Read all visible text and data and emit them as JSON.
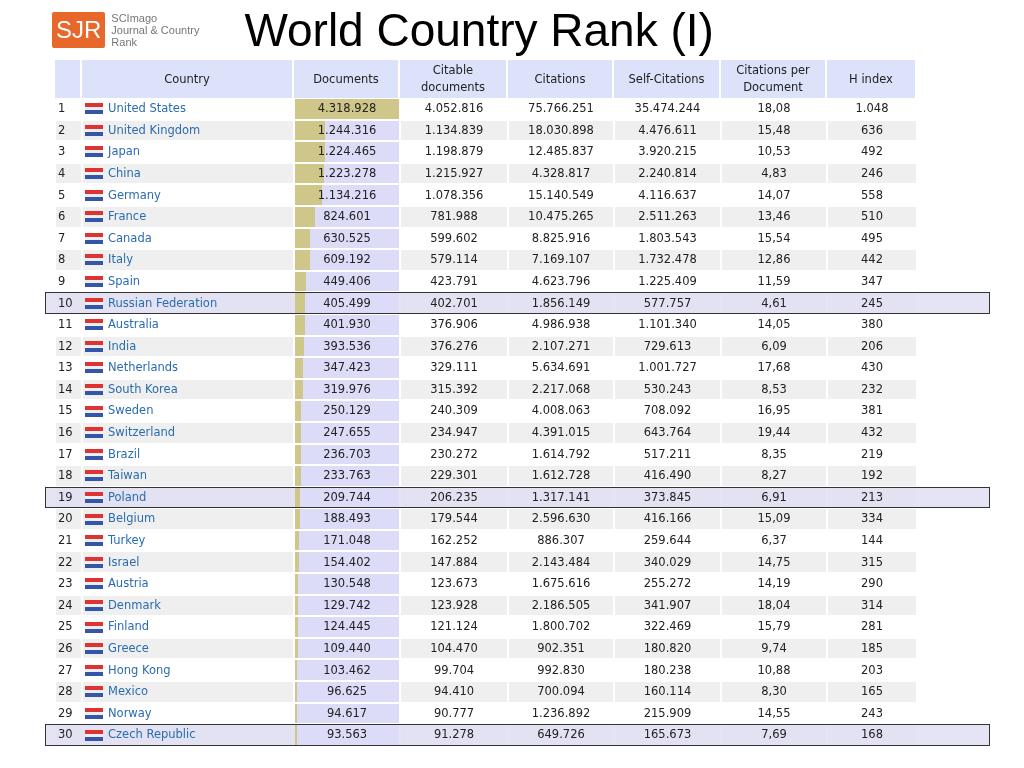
{
  "logo": {
    "mark": "SJR",
    "lines": [
      "SCImago",
      "Journal & Country",
      "Rank"
    ]
  },
  "title": "World Country Rank (I)",
  "table": {
    "columns": [
      "Country",
      "Documents",
      "Citable documents",
      "Citations",
      "Self-Citations",
      "Citations per Document",
      "H index"
    ],
    "rows": [
      {
        "rank": "1",
        "country": "United States",
        "documents": "4.318.928",
        "level": 1.0,
        "citable": "4.052.816",
        "citations": "75.766.251",
        "self_citations": "35.474.244",
        "per_document": "18,08",
        "h_index": "1.048",
        "selected": false
      },
      {
        "rank": "2",
        "country": "United Kingdom",
        "documents": "1.244.316",
        "level": 0.288,
        "citable": "1.134.839",
        "citations": "18.030.898",
        "self_citations": "4.476.611",
        "per_document": "15,48",
        "h_index": "636",
        "selected": false
      },
      {
        "rank": "3",
        "country": "Japan",
        "documents": "1.224.465",
        "level": 0.284,
        "citable": "1.198.879",
        "citations": "12.485.837",
        "self_citations": "3.920.215",
        "per_document": "10,53",
        "h_index": "492",
        "selected": false
      },
      {
        "rank": "4",
        "country": "China",
        "documents": "1.223.278",
        "level": 0.283,
        "citable": "1.215.927",
        "citations": "4.328.817",
        "self_citations": "2.240.814",
        "per_document": "4,83",
        "h_index": "246",
        "selected": false
      },
      {
        "rank": "5",
        "country": "Germany",
        "documents": "1.134.216",
        "level": 0.263,
        "citable": "1.078.356",
        "citations": "15.140.549",
        "self_citations": "4.116.637",
        "per_document": "14,07",
        "h_index": "558",
        "selected": false
      },
      {
        "rank": "6",
        "country": "France",
        "documents": "824.601",
        "level": 0.191,
        "citable": "781.988",
        "citations": "10.475.265",
        "self_citations": "2.511.263",
        "per_document": "13,46",
        "h_index": "510",
        "selected": false
      },
      {
        "rank": "7",
        "country": "Canada",
        "documents": "630.525",
        "level": 0.146,
        "citable": "599.602",
        "citations": "8.825.916",
        "self_citations": "1.803.543",
        "per_document": "15,54",
        "h_index": "495",
        "selected": false
      },
      {
        "rank": "8",
        "country": "Italy",
        "documents": "609.192",
        "level": 0.141,
        "citable": "579.114",
        "citations": "7.169.107",
        "self_citations": "1.732.478",
        "per_document": "12,86",
        "h_index": "442",
        "selected": false
      },
      {
        "rank": "9",
        "country": "Spain",
        "documents": "449.406",
        "level": 0.104,
        "citable": "423.791",
        "citations": "4.623.796",
        "self_citations": "1.225.409",
        "per_document": "11,59",
        "h_index": "347",
        "selected": false
      },
      {
        "rank": "10",
        "country": "Russian Federation",
        "documents": "405.499",
        "level": 0.094,
        "citable": "402.701",
        "citations": "1.856.149",
        "self_citations": "577.757",
        "per_document": "4,61",
        "h_index": "245",
        "selected": true
      },
      {
        "rank": "11",
        "country": "Australia",
        "documents": "401.930",
        "level": 0.093,
        "citable": "376.906",
        "citations": "4.986.938",
        "self_citations": "1.101.340",
        "per_document": "14,05",
        "h_index": "380",
        "selected": false
      },
      {
        "rank": "12",
        "country": "India",
        "documents": "393.536",
        "level": 0.091,
        "citable": "376.276",
        "citations": "2.107.271",
        "self_citations": "729.613",
        "per_document": "6,09",
        "h_index": "206",
        "selected": false
      },
      {
        "rank": "13",
        "country": "Netherlands",
        "documents": "347.423",
        "level": 0.08,
        "citable": "329.111",
        "citations": "5.634.691",
        "self_citations": "1.001.727",
        "per_document": "17,68",
        "h_index": "430",
        "selected": false
      },
      {
        "rank": "14",
        "country": "South Korea",
        "documents": "319.976",
        "level": 0.074,
        "citable": "315.392",
        "citations": "2.217.068",
        "self_citations": "530.243",
        "per_document": "8,53",
        "h_index": "232",
        "selected": false
      },
      {
        "rank": "15",
        "country": "Sweden",
        "documents": "250.129",
        "level": 0.058,
        "citable": "240.309",
        "citations": "4.008.063",
        "self_citations": "708.092",
        "per_document": "16,95",
        "h_index": "381",
        "selected": false
      },
      {
        "rank": "16",
        "country": "Switzerland",
        "documents": "247.655",
        "level": 0.057,
        "citable": "234.947",
        "citations": "4.391.015",
        "self_citations": "643.764",
        "per_document": "19,44",
        "h_index": "432",
        "selected": false
      },
      {
        "rank": "17",
        "country": "Brazil",
        "documents": "236.703",
        "level": 0.055,
        "citable": "230.272",
        "citations": "1.614.792",
        "self_citations": "517.211",
        "per_document": "8,35",
        "h_index": "219",
        "selected": false
      },
      {
        "rank": "18",
        "country": "Taiwan",
        "documents": "233.763",
        "level": 0.054,
        "citable": "229.301",
        "citations": "1.612.728",
        "self_citations": "416.490",
        "per_document": "8,27",
        "h_index": "192",
        "selected": false
      },
      {
        "rank": "19",
        "country": "Poland",
        "documents": "209.744",
        "level": 0.049,
        "citable": "206.235",
        "citations": "1.317.141",
        "self_citations": "373.845",
        "per_document": "6,91",
        "h_index": "213",
        "selected": true
      },
      {
        "rank": "20",
        "country": "Belgium",
        "documents": "188.493",
        "level": 0.044,
        "citable": "179.544",
        "citations": "2.596.630",
        "self_citations": "416.166",
        "per_document": "15,09",
        "h_index": "334",
        "selected": false
      },
      {
        "rank": "21",
        "country": "Turkey",
        "documents": "171.048",
        "level": 0.04,
        "citable": "162.252",
        "citations": "886.307",
        "self_citations": "259.644",
        "per_document": "6,37",
        "h_index": "144",
        "selected": false
      },
      {
        "rank": "22",
        "country": "Israel",
        "documents": "154.402",
        "level": 0.036,
        "citable": "147.884",
        "citations": "2.143.484",
        "self_citations": "340.029",
        "per_document": "14,75",
        "h_index": "315",
        "selected": false
      },
      {
        "rank": "23",
        "country": "Austria",
        "documents": "130.548",
        "level": 0.03,
        "citable": "123.673",
        "citations": "1.675.616",
        "self_citations": "255.272",
        "per_document": "14,19",
        "h_index": "290",
        "selected": false
      },
      {
        "rank": "24",
        "country": "Denmark",
        "documents": "129.742",
        "level": 0.03,
        "citable": "123.928",
        "citations": "2.186.505",
        "self_citations": "341.907",
        "per_document": "18,04",
        "h_index": "314",
        "selected": false
      },
      {
        "rank": "25",
        "country": "Finland",
        "documents": "124.445",
        "level": 0.029,
        "citable": "121.124",
        "citations": "1.800.702",
        "self_citations": "322.469",
        "per_document": "15,79",
        "h_index": "281",
        "selected": false
      },
      {
        "rank": "26",
        "country": "Greece",
        "documents": "109.440",
        "level": 0.025,
        "citable": "104.470",
        "citations": "902.351",
        "self_citations": "180.820",
        "per_document": "9,74",
        "h_index": "185",
        "selected": false
      },
      {
        "rank": "27",
        "country": "Hong Kong",
        "documents": "103.462",
        "level": 0.024,
        "citable": "99.704",
        "citations": "992.830",
        "self_citations": "180.238",
        "per_document": "10,88",
        "h_index": "203",
        "selected": false
      },
      {
        "rank": "28",
        "country": "Mexico",
        "documents": "96.625",
        "level": 0.022,
        "citable": "94.410",
        "citations": "700.094",
        "self_citations": "160.114",
        "per_document": "8,30",
        "h_index": "165",
        "selected": false
      },
      {
        "rank": "29",
        "country": "Norway",
        "documents": "94.617",
        "level": 0.022,
        "citable": "90.777",
        "citations": "1.236.892",
        "self_citations": "215.909",
        "per_document": "14,55",
        "h_index": "243",
        "selected": false
      },
      {
        "rank": "30",
        "country": "Czech Republic",
        "documents": "93.563",
        "level": 0.022,
        "citable": "91.278",
        "citations": "649.726",
        "self_citations": "165.673",
        "per_document": "7,69",
        "h_index": "168",
        "selected": true
      }
    ]
  }
}
